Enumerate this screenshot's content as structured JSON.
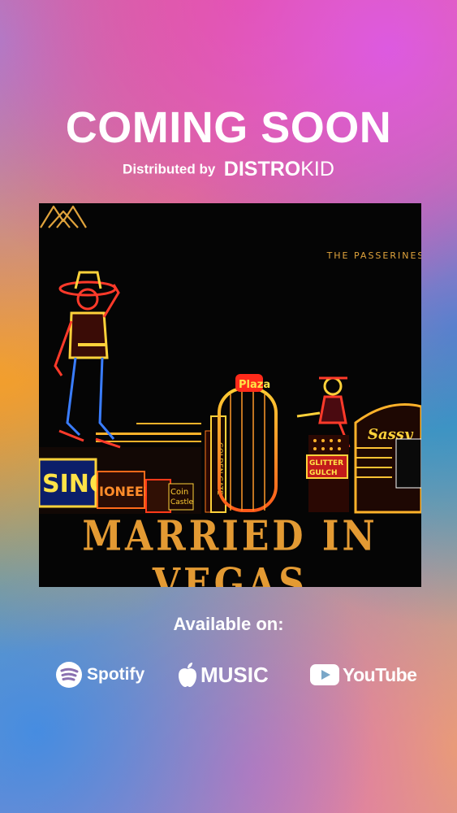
{
  "headline": "COMING SOON",
  "distribution": {
    "prefix": "Distributed by",
    "brand_bold": "DISTRO",
    "brand_light": "KID"
  },
  "album": {
    "artist": "THE PASSERINES",
    "title": "MARRIED IN VEGAS",
    "artwork_description_icon": "neon-vegas-sign-artwork",
    "accent_color": "#e39a33"
  },
  "availability": {
    "heading": "Available on:",
    "platforms": [
      {
        "label": "Spotify",
        "icon": "spotify-icon"
      },
      {
        "label": "MUSIC",
        "icon": "apple-icon"
      },
      {
        "label": "YouTube",
        "icon": "youtube-icon"
      }
    ]
  }
}
